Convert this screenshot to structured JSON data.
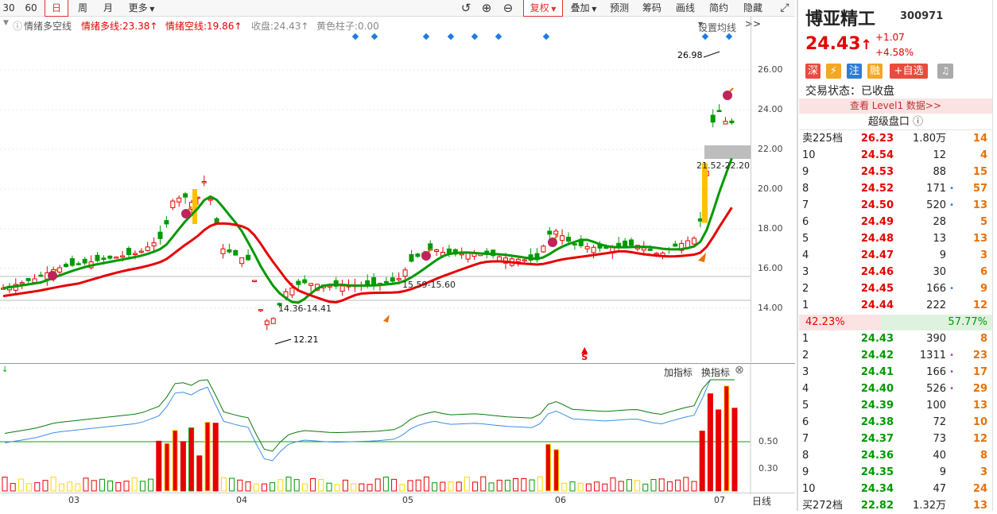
{
  "toolbar": {
    "items": [
      "30",
      "60",
      "日",
      "周",
      "月",
      "更多"
    ],
    "selected": "日",
    "right_items": [
      "复权",
      "叠加",
      "预测",
      "筹码",
      "画线",
      "简约",
      "隐藏>>"
    ]
  },
  "indicator": {
    "name": "情绪多空线",
    "bull_label": "情绪多线:23.38↑",
    "bear_label": "情绪空线:19.86↑",
    "close_label": "收盘:24.43↑",
    "yellow_label": "黄色柱子:0.00",
    "settings_label": "设置均线"
  },
  "axis": {
    "y_ticks": [
      "26.00",
      "24.00",
      "22.00",
      "20.00",
      "18.00",
      "16.00",
      "14.00"
    ],
    "x_ticks": [
      "03",
      "04",
      "05",
      "06",
      "07"
    ],
    "period_label": "日线",
    "sub_ticks": [
      "0.50",
      "0.30"
    ]
  },
  "annotations": {
    "high": "26.98",
    "low": "12.21",
    "range1": "14.36-14.41",
    "range2": "15.59-15.60",
    "range3": "21.52-22.20",
    "marker": "S"
  },
  "subchart": {
    "add_label": "加指标",
    "switch_label": "换指标"
  },
  "stock": {
    "name": "博亚精工",
    "code": "300971",
    "price": "24.43",
    "arrow": "↑",
    "change": "+1.07",
    "change_pct": "+4.58%",
    "badges": [
      "深",
      "⚡",
      "注",
      "融"
    ],
    "add_watch": "+自选",
    "status": "交易状态：已收盘",
    "level1": "查看 Level1 数据>>",
    "super_panel": "超级盘口"
  },
  "orderbook": {
    "sell_summary": {
      "label": "卖225档",
      "price": "26.23",
      "vol": "1.80万",
      "count": "14"
    },
    "sells": [
      {
        "label": "10",
        "price": "24.54",
        "vol": "12",
        "count": "4",
        "dot": ""
      },
      {
        "label": "9",
        "price": "24.53",
        "vol": "88",
        "count": "15",
        "dot": ""
      },
      {
        "label": "8",
        "price": "24.52",
        "vol": "171",
        "count": "57",
        "dot": "•"
      },
      {
        "label": "7",
        "price": "24.50",
        "vol": "520",
        "count": "13",
        "dot": "•"
      },
      {
        "label": "6",
        "price": "24.49",
        "vol": "28",
        "count": "5",
        "dot": ""
      },
      {
        "label": "5",
        "price": "24.48",
        "vol": "13",
        "count": "13",
        "dot": ""
      },
      {
        "label": "4",
        "price": "24.47",
        "vol": "9",
        "count": "3",
        "dot": ""
      },
      {
        "label": "3",
        "price": "24.46",
        "vol": "30",
        "count": "6",
        "dot": ""
      },
      {
        "label": "2",
        "price": "24.45",
        "vol": "166",
        "count": "9",
        "dot": "•"
      },
      {
        "label": "1",
        "price": "24.44",
        "vol": "222",
        "count": "12",
        "dot": ""
      }
    ],
    "ratio_left": "42.23%",
    "ratio_right": "57.77%",
    "ratio_value": 0.4223,
    "buys": [
      {
        "label": "1",
        "price": "24.43",
        "vol": "390",
        "count": "8",
        "dot": ""
      },
      {
        "label": "2",
        "price": "24.42",
        "vol": "1311",
        "count": "23",
        "dot": "•"
      },
      {
        "label": "3",
        "price": "24.41",
        "vol": "166",
        "count": "17",
        "dot": "•"
      },
      {
        "label": "4",
        "price": "24.40",
        "vol": "526",
        "count": "29",
        "dot": "•"
      },
      {
        "label": "5",
        "price": "24.39",
        "vol": "100",
        "count": "13",
        "dot": ""
      },
      {
        "label": "6",
        "price": "24.38",
        "vol": "72",
        "count": "10",
        "dot": ""
      },
      {
        "label": "7",
        "price": "24.37",
        "vol": "73",
        "count": "12",
        "dot": ""
      },
      {
        "label": "8",
        "price": "24.36",
        "vol": "40",
        "count": "8",
        "dot": ""
      },
      {
        "label": "9",
        "price": "24.35",
        "vol": "9",
        "count": "3",
        "dot": ""
      },
      {
        "label": "10",
        "price": "24.34",
        "vol": "47",
        "count": "24",
        "dot": ""
      }
    ],
    "buy_summary": {
      "label": "买272档",
      "price": "22.82",
      "vol": "1.32万",
      "count": "13"
    }
  },
  "colors": {
    "up": "#e60000",
    "down": "#009900",
    "bull": "#e60000",
    "bear": "#009900",
    "orange": "#e8700a",
    "yellow": "#ffc000"
  }
}
